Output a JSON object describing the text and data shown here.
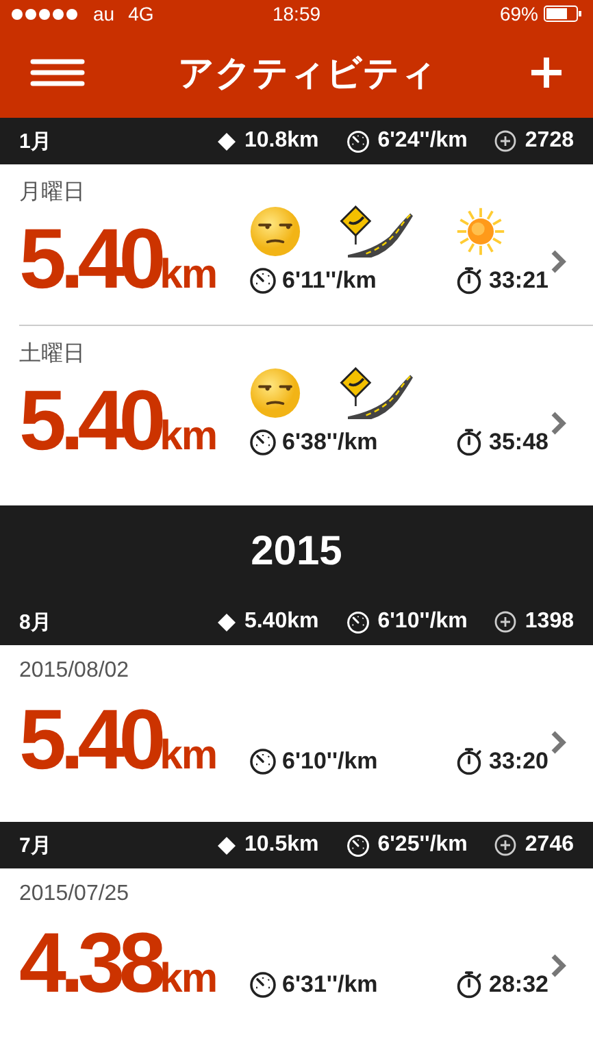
{
  "status_bar": {
    "carrier": "au",
    "network": "4G",
    "time": "18:59",
    "battery": "69%"
  },
  "nav": {
    "title": "アクティビティ"
  },
  "sections": [
    {
      "kind": "month",
      "label": "1月",
      "distance": "10.8km",
      "pace": "6'24''/km",
      "calories": "2728",
      "runs": [
        {
          "date": "月曜日",
          "distance": "5.40",
          "unit": "km",
          "pace": "6'11''/km",
          "duration": "33:21",
          "icons": [
            {
              "kind": "face"
            },
            {
              "kind": "road"
            },
            {
              "kind": "sun"
            }
          ]
        },
        {
          "date": "土曜日",
          "distance": "5.40",
          "unit": "km",
          "pace": "6'38''/km",
          "duration": "35:48",
          "icons": [
            {
              "kind": "face"
            },
            {
              "kind": "road"
            }
          ]
        }
      ]
    },
    {
      "kind": "year",
      "label": "2015"
    },
    {
      "kind": "month",
      "label": "8月",
      "distance": "5.40km",
      "pace": "6'10''/km",
      "calories": "1398",
      "runs": [
        {
          "date": "2015/08/02",
          "distance": "5.40",
          "unit": "km",
          "pace": "6'10''/km",
          "duration": "33:20"
        }
      ]
    },
    {
      "kind": "month",
      "label": "7月",
      "distance": "10.5km",
      "pace": "6'25''/km",
      "calories": "2746",
      "runs": [
        {
          "date": "2015/07/25",
          "distance": "4.38",
          "unit": "km",
          "pace": "6'31''/km",
          "duration": "28:32"
        }
      ]
    }
  ]
}
